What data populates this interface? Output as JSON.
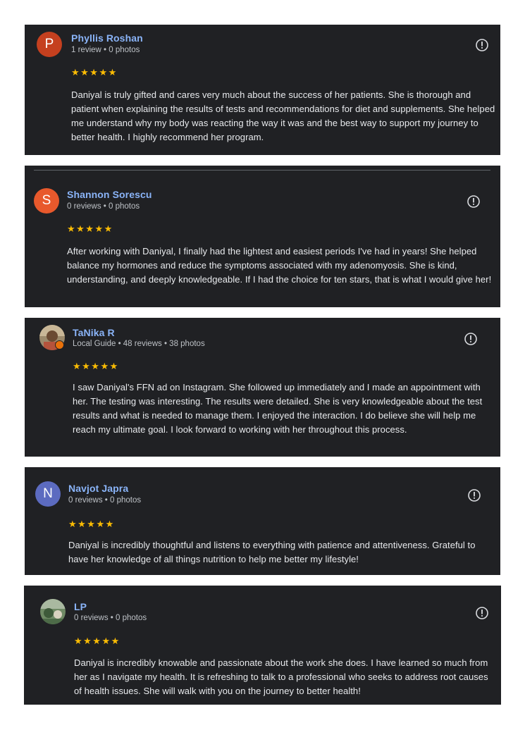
{
  "reviews": [
    {
      "initial": "P",
      "avatar_color": "#c5401f",
      "name": "Phyllis Roshan",
      "meta": "1 review • 0 photos",
      "stars": "★★★★★",
      "rating": 5,
      "text": "Daniyal is truly gifted and cares very much about the success of her patients. She is thorough and patient when explaining the results of tests and recommendations for diet and supplements. She helped me understand why my body was reacting the way it was and the best way to support my journey to better health. I highly recommend her program."
    },
    {
      "initial": "S",
      "avatar_color": "#e8592c",
      "name": "Shannon Sorescu",
      "meta": "0 reviews • 0 photos",
      "stars": "★★★★★",
      "rating": 5,
      "text": "After working with Daniyal, I finally had the lightest and easiest periods I've had in years! She helped balance my hormones and reduce the symptoms associated with my adenomyosis. She is kind, understanding, and deeply knowledgeable. If I had the choice for ten stars, that is what I would give her!"
    },
    {
      "initial": "",
      "avatar_color": "#8a7a5e",
      "name": "TaNika R",
      "meta": "Local Guide • 48 reviews • 38 photos",
      "stars": "★★★★★",
      "rating": 5,
      "text": "I saw Daniyal's FFN ad on Instagram. She followed up immediately and I made an appointment with her. The testing was interesting. The results were detailed. She is very knowledgeable about the test results and what is needed to manage them. I enjoyed the interaction. I do believe she will help me reach my ultimate goal. I look forward to working with her throughout this process."
    },
    {
      "initial": "N",
      "avatar_color": "#5c6bc0",
      "name": "Navjot Japra",
      "meta": "0 reviews • 0 photos",
      "stars": "★★★★★",
      "rating": 5,
      "text": "Daniyal is incredibly thoughtful and listens to everything with patience and attentiveness. Grateful to have her knowledge of all things nutrition to help me better my lifestyle!"
    },
    {
      "initial": "",
      "avatar_color": "#5f7a5a",
      "name": "LP",
      "meta": "0 reviews • 0 photos",
      "stars": "★★★★★",
      "rating": 5,
      "text": "Daniyal is incredibly knowable and passionate about the work she does. I have learned so much from her as I navigate my health. It is refreshing to talk to a professional who seeks to address root causes of health issues. She will walk with you on the journey to better health!"
    }
  ]
}
